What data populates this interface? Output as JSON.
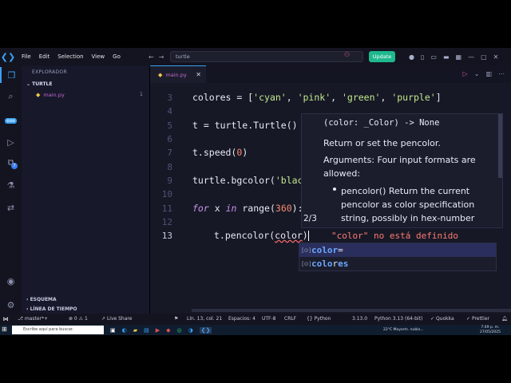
{
  "menu": [
    "File",
    "Edit",
    "Selection",
    "View",
    "Go"
  ],
  "search": {
    "value": "turtle"
  },
  "update_label": "Update",
  "sidebar": {
    "title": "EXPLORADOR",
    "folder": "TURTLE",
    "file": "main.py",
    "file_badge": "1",
    "outline": "ESQUEMA",
    "timeline": "LÍNEA DE TIEMPO"
  },
  "tab": {
    "label": "main.py"
  },
  "activity_badge": "7",
  "lines": {
    "l3": "3",
    "l4": "4",
    "l5": "5",
    "l6": "6",
    "l7": "7",
    "l8": "8",
    "l9": "9",
    "l10": "10",
    "l11": "11",
    "l12": "12",
    "l13": "13"
  },
  "code": {
    "c3_a": "colores = [",
    "c3_s1": "'cyan'",
    "c3_s2": "'pink'",
    "c3_s3": "'green'",
    "c3_s4": "'purple'",
    "c3_end": "]",
    "c5": "t = turtle.Turtle()",
    "c7_a": "t.speed(",
    "c7_n": "0",
    "c7_b": ")",
    "c9_a": "turtle.bgcolor(",
    "c9_s": "'blac",
    "c11_kw1": "for",
    "c11_x": " x ",
    "c11_kw2": "in",
    "c11_fn": " range(",
    "c11_n": "360",
    "c11_b": "):",
    "c13_a": "t.pencolor(",
    "c13_b": "color",
    "c13_c": ")"
  },
  "hover": {
    "signature": "(color: _Color) -> None",
    "line1": "Return or set the pencolor.",
    "line2": "Arguments: Four input formats are allowed:",
    "bullet": "pencolor() Return the current pencolor as color specification string, possibly in hex-number",
    "pager": "2/3"
  },
  "diagnostic": "\"color\" no está definido",
  "suggest": {
    "item1_match": "color",
    "item1_rest": "=",
    "item2_match": "colo",
    "item2_mid": "r",
    "item2_rest": "es"
  },
  "status": {
    "branch": "master*+",
    "sync": "⊗ 0 ⚠ 1",
    "live": "Live Share",
    "position": "Lín. 13, col. 21",
    "spaces": "Espacios: 4",
    "encoding": "UTF-8",
    "eol": "CRLF",
    "language": "Python",
    "version": "3.13.0",
    "interpreter": "Python 3.13 (64-bit)",
    "quokka": "Quokka",
    "prettier": "Prettier"
  },
  "taskbar": {
    "search_placeholder": "Escribe aquí para buscar.",
    "weather": "22°C Mayorm. nubla...",
    "time": "7:49 p. m.",
    "date": "27/05/2025"
  }
}
